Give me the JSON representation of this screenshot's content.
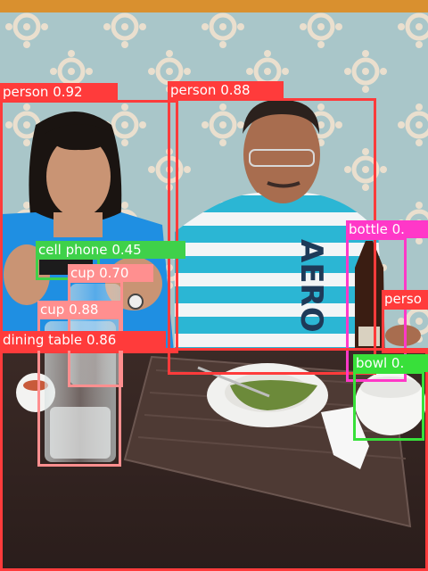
{
  "detections": [
    {
      "name": "det-person-left",
      "label": "person",
      "score": "0.92",
      "color": "#ff3b3b",
      "text_color": "#ffffff"
    },
    {
      "name": "det-person-right",
      "label": "person",
      "score": "0.88",
      "color": "#ff3b3b",
      "text_color": "#ffffff"
    },
    {
      "name": "det-bottle",
      "label": "bottle",
      "score": "0.",
      "color": "#ff38c8",
      "text_color": "#ffffff"
    },
    {
      "name": "det-person-edge",
      "label": "perso",
      "score": "",
      "color": "#ff3b3b",
      "text_color": "#ffffff"
    },
    {
      "name": "det-cell-phone",
      "label": "cell phone",
      "score": "0.45",
      "color": "#3fd14a",
      "text_color": "#ffffff"
    },
    {
      "name": "det-cup-small",
      "label": "cup",
      "score": "0.70",
      "color": "#ff8f8f",
      "text_color": "#ffffff"
    },
    {
      "name": "det-cup-large",
      "label": "cup",
      "score": "0.88",
      "color": "#ff8f8f",
      "text_color": "#ffffff"
    },
    {
      "name": "det-dining-table",
      "label": "dining table",
      "score": "0.86",
      "color": "#ff3b3b",
      "text_color": "#ffffff"
    },
    {
      "name": "det-bowl",
      "label": "bowl",
      "score": "0.",
      "color": "#38e03a",
      "text_color": "#ffffff"
    }
  ]
}
